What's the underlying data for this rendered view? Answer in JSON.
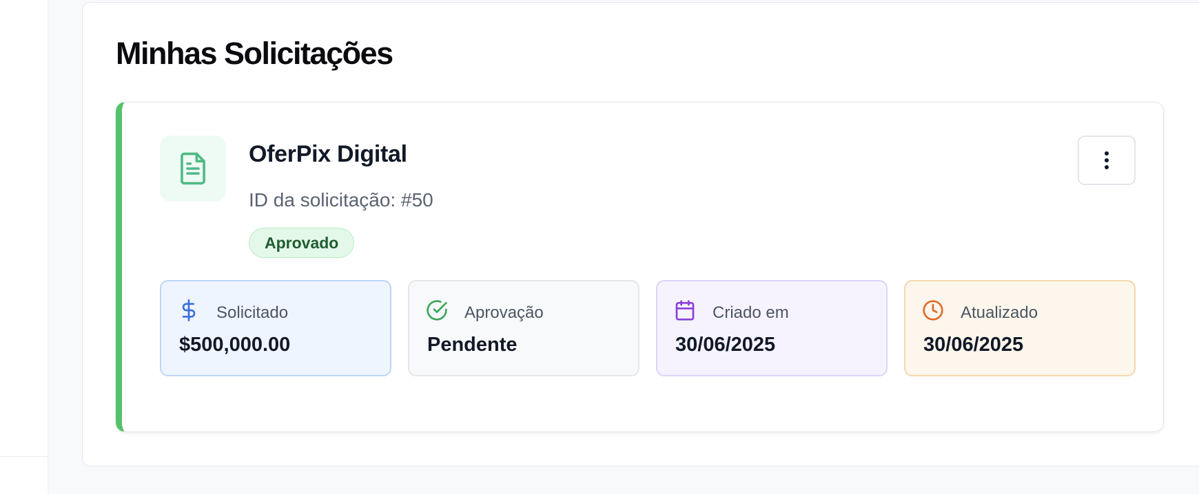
{
  "page": {
    "title": "Minhas Solicitações"
  },
  "request": {
    "name": "OferPix Digital",
    "id_text": "ID da solicitação: #50",
    "status": "Aprovado",
    "stats": {
      "requested": {
        "label": "Solicitado",
        "value": "$500,000.00",
        "icon": "dollar-icon"
      },
      "approval": {
        "label": "Aprovação",
        "value": "Pendente",
        "icon": "check-circle-icon"
      },
      "created": {
        "label": "Criado em",
        "value": "30/06/2025",
        "icon": "calendar-icon"
      },
      "updated": {
        "label": "Atualizado",
        "value": "30/06/2025",
        "icon": "clock-icon"
      }
    }
  },
  "colors": {
    "accent_green": "#55c16a",
    "status_pill_bg": "#e4f8e9",
    "status_pill_text": "#1f5c30",
    "blue": "#3b6fd8",
    "green": "#3ea55a",
    "purple": "#8b3fd9",
    "orange": "#e06a2a"
  }
}
